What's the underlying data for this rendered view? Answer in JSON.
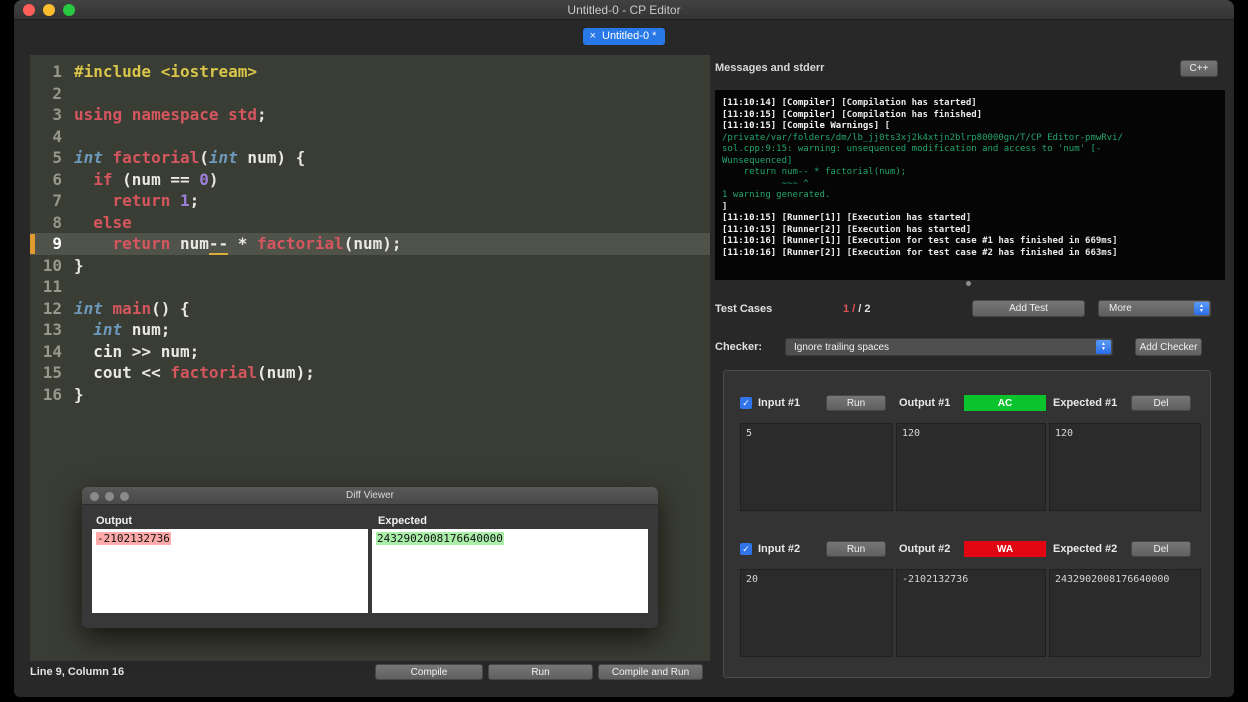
{
  "titlebar": {
    "title": "Untitled-0 - CP Editor"
  },
  "tab": {
    "close_icon": "×",
    "label": "Untitled-0 *"
  },
  "icons": {
    "checkbox_check": "✓",
    "stepper_up": "▲",
    "stepper_down": "▼"
  },
  "editor": {
    "current_line": 9,
    "status": "Line 9, Column 16",
    "lines": [
      {
        "n": 1,
        "tokens": [
          {
            "c": "pp",
            "t": "#include <iostream>"
          }
        ]
      },
      {
        "n": 2,
        "tokens": []
      },
      {
        "n": 3,
        "tokens": [
          {
            "c": "kw",
            "t": "using namespace std"
          },
          {
            "c": "pl",
            "t": ";"
          }
        ]
      },
      {
        "n": 4,
        "tokens": []
      },
      {
        "n": 5,
        "tokens": [
          {
            "c": "ty",
            "t": "int"
          },
          {
            "c": "pl",
            "t": " "
          },
          {
            "c": "fn",
            "t": "factorial"
          },
          {
            "c": "pl",
            "t": "("
          },
          {
            "c": "ty",
            "t": "int"
          },
          {
            "c": "pl",
            "t": " num) {"
          }
        ]
      },
      {
        "n": 6,
        "tokens": [
          {
            "c": "pl",
            "t": "  "
          },
          {
            "c": "kw",
            "t": "if"
          },
          {
            "c": "pl",
            "t": " (num == "
          },
          {
            "c": "nu",
            "t": "0"
          },
          {
            "c": "pl",
            "t": ")"
          }
        ]
      },
      {
        "n": 7,
        "tokens": [
          {
            "c": "pl",
            "t": "    "
          },
          {
            "c": "kw",
            "t": "return"
          },
          {
            "c": "pl",
            "t": " "
          },
          {
            "c": "nu",
            "t": "1"
          },
          {
            "c": "pl",
            "t": ";"
          }
        ]
      },
      {
        "n": 8,
        "tokens": [
          {
            "c": "pl",
            "t": "  "
          },
          {
            "c": "kw",
            "t": "else"
          }
        ]
      },
      {
        "n": 9,
        "tokens": [
          {
            "c": "pl",
            "t": "    "
          },
          {
            "c": "kw",
            "t": "return"
          },
          {
            "c": "pl",
            "t": " num"
          },
          {
            "c": "wn",
            "t": "--"
          },
          {
            "c": "pl",
            "t": " * "
          },
          {
            "c": "fn",
            "t": "factorial"
          },
          {
            "c": "pl",
            "t": "(num);"
          }
        ]
      },
      {
        "n": 10,
        "tokens": [
          {
            "c": "pl",
            "t": "}"
          }
        ]
      },
      {
        "n": 11,
        "tokens": []
      },
      {
        "n": 12,
        "tokens": [
          {
            "c": "ty",
            "t": "int"
          },
          {
            "c": "pl",
            "t": " "
          },
          {
            "c": "fn",
            "t": "main"
          },
          {
            "c": "pl",
            "t": "() {"
          }
        ]
      },
      {
        "n": 13,
        "tokens": [
          {
            "c": "pl",
            "t": "  "
          },
          {
            "c": "ty",
            "t": "int"
          },
          {
            "c": "pl",
            "t": " num;"
          }
        ]
      },
      {
        "n": 14,
        "tokens": [
          {
            "c": "pl",
            "t": "  cin >> num;"
          }
        ]
      },
      {
        "n": 15,
        "tokens": [
          {
            "c": "pl",
            "t": "  cout << "
          },
          {
            "c": "fn",
            "t": "factorial"
          },
          {
            "c": "pl",
            "t": "(num);"
          }
        ]
      },
      {
        "n": 16,
        "tokens": [
          {
            "c": "pl",
            "t": "}"
          }
        ]
      }
    ]
  },
  "actions": {
    "compile": "Compile",
    "run": "Run",
    "compile_and_run": "Compile and Run"
  },
  "diff_viewer": {
    "title": "Diff Viewer",
    "output_label": "Output",
    "expected_label": "Expected",
    "output_value": "-2102132736",
    "expected_value": "2432902008176640000",
    "output_highlight_color": "#ffaaaa",
    "expected_highlight_color": "#aaeeaa"
  },
  "messages": {
    "title": "Messages and stderr",
    "language_button": "C++",
    "log": [
      {
        "segs": [
          {
            "c": "b",
            "t": "[11:10:14] [Compiler] "
          },
          {
            "c": "w",
            "t": "[Compilation has started]"
          }
        ]
      },
      {
        "segs": [
          {
            "c": "b",
            "t": "[11:10:15] [Compiler] "
          },
          {
            "c": "w",
            "t": "[Compilation has finished]"
          }
        ]
      },
      {
        "segs": [
          {
            "c": "b",
            "t": "[11:10:15] [Compile Warnings] "
          },
          {
            "c": "w",
            "t": "["
          }
        ]
      },
      {
        "segs": [
          {
            "c": "g",
            "t": "/private/var/folders/dm/lb_jj0ts3xj2k4xtjn2blrp80000gn/T/CP Editor-pmwRvi/"
          }
        ]
      },
      {
        "segs": [
          {
            "c": "g",
            "t": "sol.cpp:9:15: warning: unsequenced modification and access to 'num' [-"
          }
        ]
      },
      {
        "segs": [
          {
            "c": "g",
            "t": "Wunsequenced]"
          }
        ]
      },
      {
        "segs": [
          {
            "c": "g",
            "t": "    return num-- * factorial(num);"
          }
        ]
      },
      {
        "segs": [
          {
            "c": "g",
            "t": "           ~~~ ^"
          }
        ]
      },
      {
        "segs": [
          {
            "c": "g",
            "t": "1 warning generated."
          }
        ]
      },
      {
        "segs": [
          {
            "c": "w",
            "t": "]"
          }
        ]
      },
      {
        "segs": [
          {
            "c": "b",
            "t": "[11:10:15] [Runner[1]] "
          },
          {
            "c": "w",
            "t": "[Execution has started]"
          }
        ]
      },
      {
        "segs": [
          {
            "c": "b",
            "t": "[11:10:15] [Runner[2]] "
          },
          {
            "c": "w",
            "t": "[Execution has started]"
          }
        ]
      },
      {
        "segs": [
          {
            "c": "b",
            "t": "[11:10:16] [Runner[1]] "
          },
          {
            "c": "w",
            "t": "[Execution for test case #1 has finished in 669ms]"
          }
        ]
      },
      {
        "segs": [
          {
            "c": "b",
            "t": "[11:10:16] [Runner[2]] "
          },
          {
            "c": "w",
            "t": "[Execution for test case #2 has finished in 663ms]"
          }
        ]
      }
    ]
  },
  "testcases": {
    "title": "Test Cases",
    "summary": [
      {
        "t": "1 / ",
        "c": "#e05555"
      },
      {
        "t": "/ 2",
        "c": "#dddddd"
      }
    ],
    "add_test": "Add Test",
    "more": "More",
    "checker_label": "Checker:",
    "checker_value": "Ignore trailing spaces",
    "add_checker": "Add Checker",
    "cases": [
      {
        "input_label": "Input #1",
        "run": "Run",
        "output_label": "Output #1",
        "verdict": "AC",
        "verdict_color": "#0bc32c",
        "expected_label": "Expected #1",
        "del": "Del",
        "input": "5",
        "output": "120",
        "expected": "120"
      },
      {
        "input_label": "Input #2",
        "run": "Run",
        "output_label": "Output #2",
        "verdict": "WA",
        "verdict_color": "#e20613",
        "expected_label": "Expected #2",
        "del": "Del",
        "input": "20",
        "output": "-2102132736",
        "expected": "2432902008176640000"
      }
    ]
  }
}
